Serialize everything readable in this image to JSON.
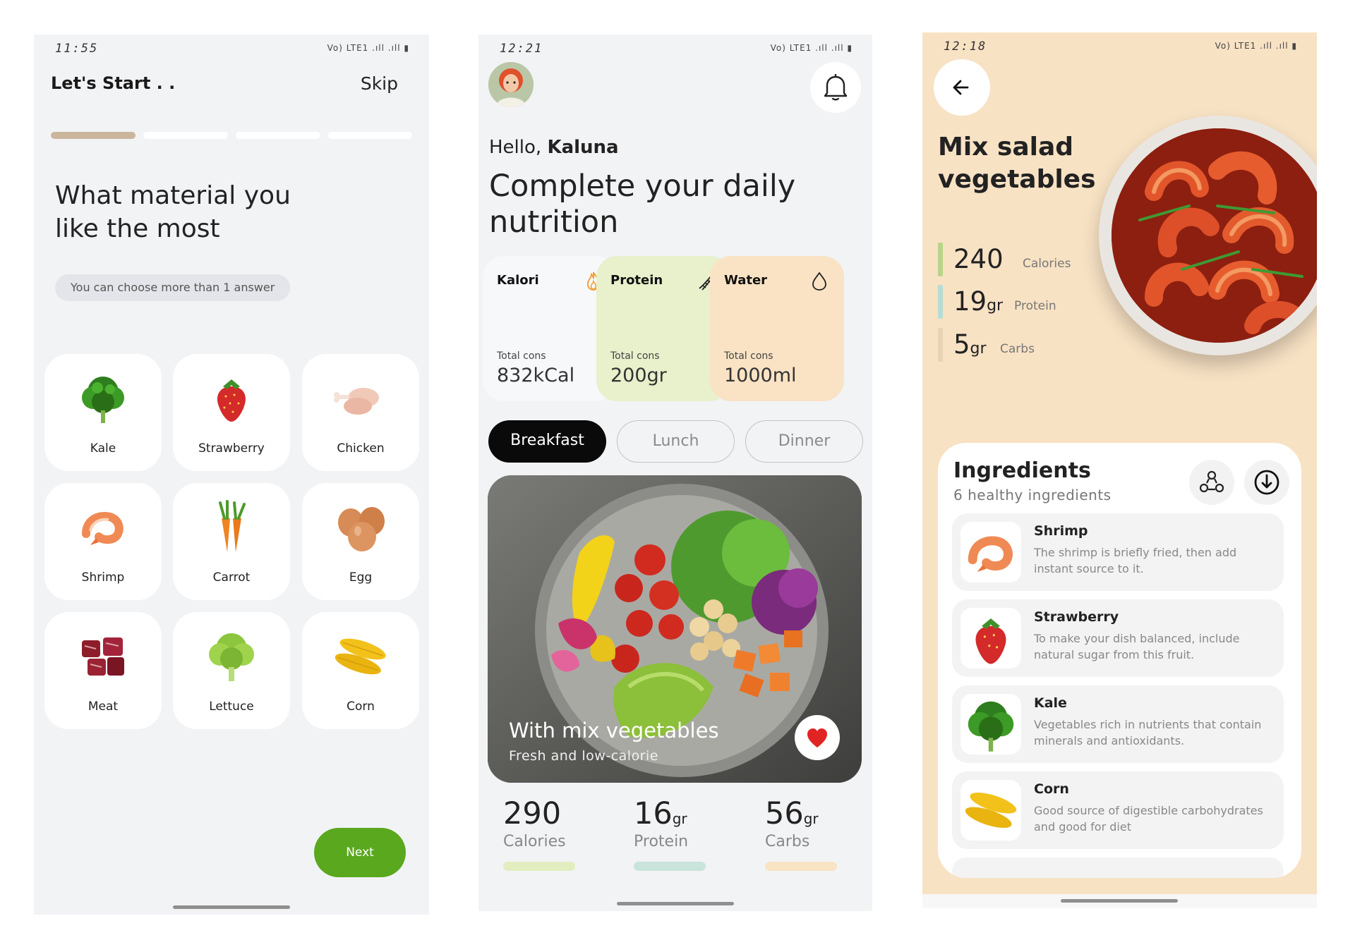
{
  "screen1": {
    "status_time": "11:55",
    "status_icons": "Vo) LTE1 .ıll .ıll ▮",
    "title": "Let's Start . .",
    "skip_label": "Skip",
    "progress": {
      "current_step": 1,
      "total_steps": 4
    },
    "question": "What material you like the most",
    "hint": "You can choose more than 1 answer",
    "options": [
      {
        "label": "Kale",
        "icon": "kale-icon"
      },
      {
        "label": "Strawberry",
        "icon": "strawberry-icon"
      },
      {
        "label": "Chicken",
        "icon": "chicken-icon"
      },
      {
        "label": "Shrimp",
        "icon": "shrimp-icon"
      },
      {
        "label": "Carrot",
        "icon": "carrot-icon"
      },
      {
        "label": "Egg",
        "icon": "egg-icon"
      },
      {
        "label": "Meat",
        "icon": "meat-icon"
      },
      {
        "label": "Lettuce",
        "icon": "lettuce-icon"
      },
      {
        "label": "Corn",
        "icon": "corn-icon"
      }
    ],
    "next_label": "Next"
  },
  "screen2": {
    "status_time": "12:21",
    "status_icons": "Vo) LTE1 .ıll .ıll ▮",
    "greeting_prefix": "Hello, ",
    "user_name": "Kaluna",
    "headline": "Complete your daily nutrition",
    "cards": [
      {
        "label": "Kalori",
        "cons_label": "Total cons",
        "value": "832",
        "unit": "kCal",
        "icon": "flame-icon"
      },
      {
        "label": "Protein",
        "cons_label": "Total cons",
        "value": "200",
        "unit": "gr",
        "icon": "dna-icon"
      },
      {
        "label": "Water",
        "cons_label": "Total cons",
        "value": "1000",
        "unit": "ml",
        "icon": "water-drop-icon"
      }
    ],
    "meal_tabs": [
      "Breakfast",
      "Lunch",
      "Dinner"
    ],
    "active_meal_tab": "Breakfast",
    "meal": {
      "title": "With mix vegetables",
      "subtitle": "Fresh and low-calorie",
      "favorite": true
    },
    "stats": [
      {
        "value": "290",
        "unit": "",
        "label": "Calories",
        "color": "#e2edc0"
      },
      {
        "value": "16",
        "unit": "gr",
        "label": "Protein",
        "color": "#c9e4da"
      },
      {
        "value": "56",
        "unit": "gr",
        "label": "Carbs",
        "color": "#f8e3c3"
      }
    ]
  },
  "screen3": {
    "status_time": "12:18",
    "status_icons": "Vo) LTE1 .ıll .ıll ▮",
    "dish_title": "Mix salad vegetables",
    "stats": [
      {
        "value": "240",
        "unit": "",
        "label": "Calories",
        "color": "#b9d38a"
      },
      {
        "value": "19",
        "unit": "gr",
        "label": "Protein",
        "color": "#b7dcd5"
      },
      {
        "value": "5",
        "unit": "gr",
        "label": "Carbs",
        "color": "#e8d3b4"
      }
    ],
    "ingredients_title": "Ingredients",
    "ingredients_subtitle": "6 healthy ingredients",
    "ingredients": [
      {
        "name": "Shrimp",
        "desc": "The shrimp is briefly fried, then add instant source to it.",
        "icon": "shrimp-icon"
      },
      {
        "name": "Strawberry",
        "desc": "To make your dish balanced, include natural sugar from this fruit.",
        "icon": "strawberry-icon"
      },
      {
        "name": "Kale",
        "desc": "Vegetables rich in nutrients that contain minerals and antioxidants.",
        "icon": "kale-icon"
      },
      {
        "name": "Corn",
        "desc": "Good source of digestible carbohydrates and good for diet",
        "icon": "corn-icon"
      }
    ]
  },
  "colors": {
    "accent_green": "#5aa81e",
    "progress_active": "#cbb69d",
    "card_kalori": "#f7f8fa",
    "card_protein": "#e8f0cc",
    "card_water": "#f9e3c4",
    "detail_background": "#f8e2c4",
    "heart": "#e02424"
  }
}
